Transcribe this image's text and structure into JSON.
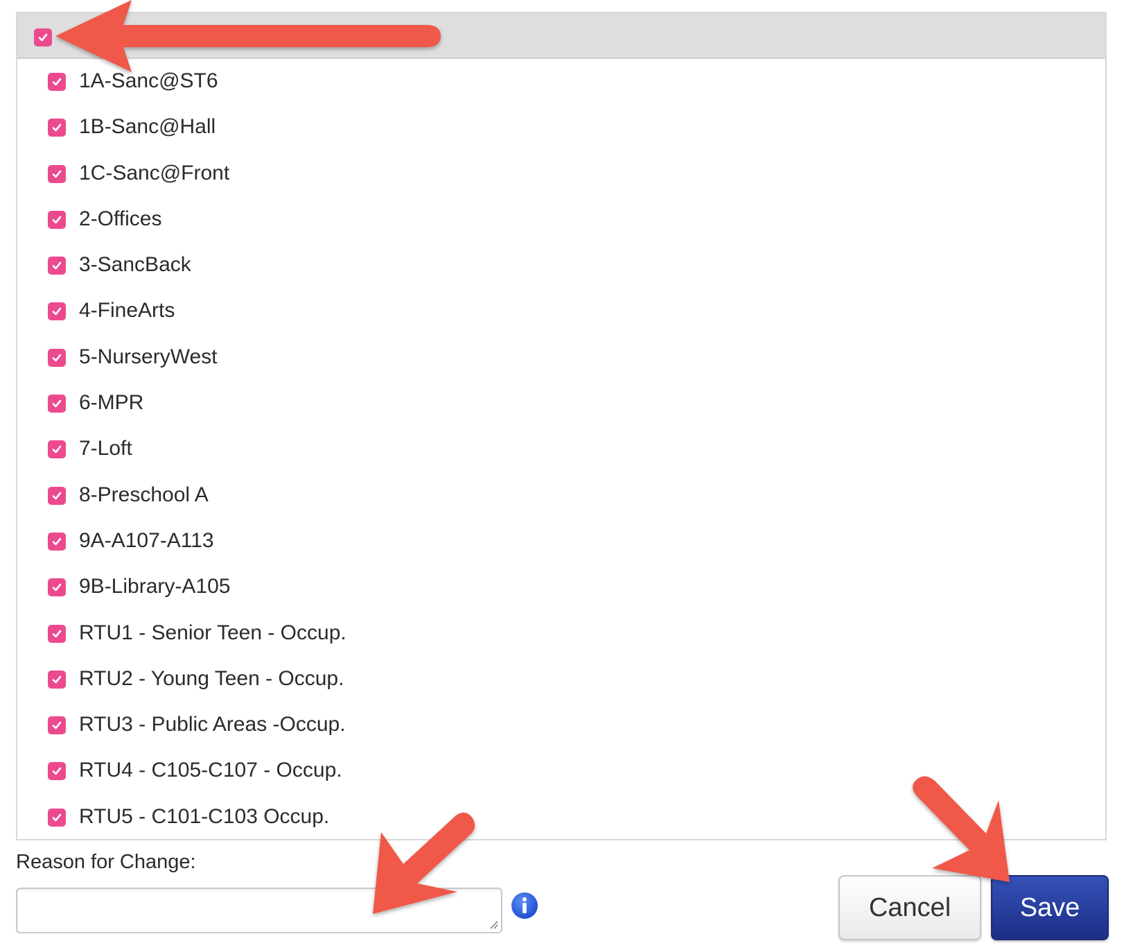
{
  "zones": {
    "select_all_checked": true,
    "items": [
      {
        "label": "1A-Sanc@ST6",
        "checked": true
      },
      {
        "label": "1B-Sanc@Hall",
        "checked": true
      },
      {
        "label": "1C-Sanc@Front",
        "checked": true
      },
      {
        "label": "2-Offices",
        "checked": true
      },
      {
        "label": "3-SancBack",
        "checked": true
      },
      {
        "label": "4-FineArts",
        "checked": true
      },
      {
        "label": "5-NurseryWest",
        "checked": true
      },
      {
        "label": "6-MPR",
        "checked": true
      },
      {
        "label": "7-Loft",
        "checked": true
      },
      {
        "label": "8-Preschool A",
        "checked": true
      },
      {
        "label": "9A-A107-A113",
        "checked": true
      },
      {
        "label": "9B-Library-A105",
        "checked": true
      },
      {
        "label": "RTU1 - Senior Teen - Occup.",
        "checked": true
      },
      {
        "label": "RTU2 - Young Teen - Occup.",
        "checked": true
      },
      {
        "label": "RTU3 - Public Areas -Occup.",
        "checked": true
      },
      {
        "label": "RTU4 - C105-C107 - Occup.",
        "checked": true
      },
      {
        "label": "RTU5 - C101-C103 Occup.",
        "checked": true
      }
    ]
  },
  "reason": {
    "label": "Reason for Change:",
    "value": ""
  },
  "actions": {
    "cancel_label": "Cancel",
    "save_label": "Save"
  },
  "colors": {
    "checkbox": "#ec4a8f",
    "save_button": "#1d2e86",
    "info_icon": "#2f5fd8",
    "annotation_arrow": "#f0584a"
  },
  "icons": {
    "checkbox": "checkmark-icon",
    "info": "info-icon",
    "annotation": "arrow-icon"
  }
}
